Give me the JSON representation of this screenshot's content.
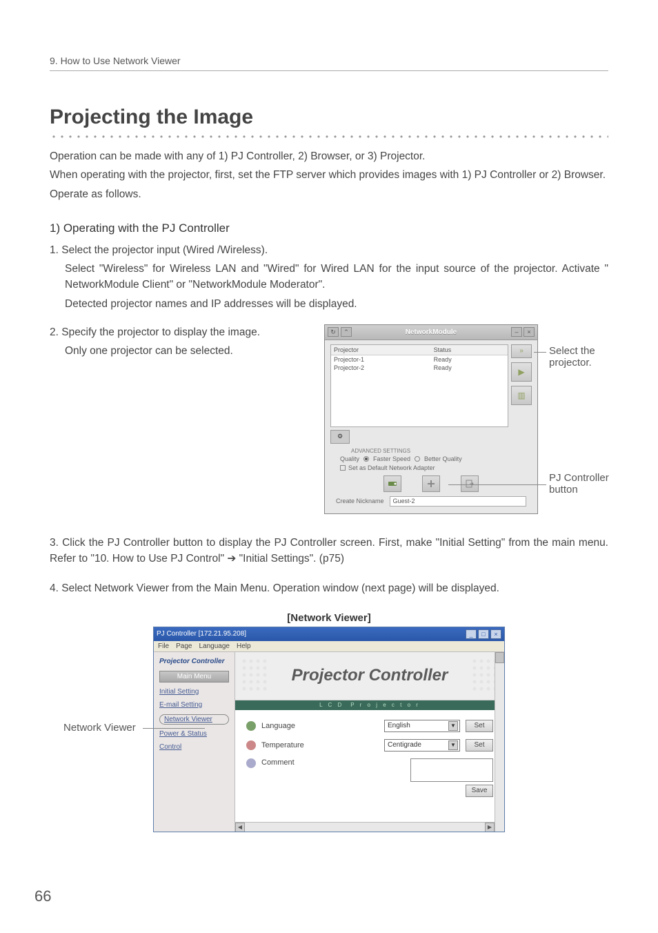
{
  "header": {
    "chapter": "9. How to Use Network Viewer"
  },
  "title": "Projecting the Image",
  "intro": {
    "p1": "Operation can be made with any of 1) PJ Controller, 2) Browser, or 3) Projector.",
    "p2": "When operating with the projector, first, set the FTP server which provides images with 1) PJ Controller or 2) Browser.",
    "p3": "Operate as follows."
  },
  "section1_title": "1) Operating with the PJ Controller",
  "steps": {
    "s1_num": "1. Select the projector input (Wired /Wireless).",
    "s1_body": "Select \"Wireless\" for Wireless LAN and \"Wired\" for Wired LAN for the input source of the projector.  Activate \" NetworkModule Client\" or \"NetworkModule Moderator\".",
    "s1_tail": "Detected projector names and IP addresses will be displayed.",
    "s2_num": "2. Specify the projector to display the image.",
    "s2_body": "Only one projector can be selected.",
    "s3": "3. Click the PJ Controller button to display the PJ Controller screen.  First, make \"Initial Setting\" from the main menu.  Refer to \"10. How to Use PJ Control\" ➔ \"Initial Settings\".  (p75)",
    "s4": "4. Select Network Viewer from the Main Menu. Operation window (next page) will be displayed."
  },
  "nm": {
    "title": "NetworkModule",
    "col_projector": "Projector",
    "col_status": "Status",
    "rows": [
      {
        "name": "Projector-1",
        "status": "Ready"
      },
      {
        "name": "Projector-2",
        "status": "Ready"
      }
    ],
    "adv_label": "ADVANCED SETTINGS",
    "quality_label": "Quality",
    "opt_faster": "Faster Speed",
    "opt_better": "Better Quality",
    "set_default": "Set as Default Network Adapter",
    "create_nick": "Create Nickname",
    "nick_value": "Guest-2"
  },
  "annotations": {
    "select_projector": "Select the projector.",
    "pj_button": "PJ Controller button"
  },
  "nv_caption": "[Network Viewer]",
  "nv_label": "Network Viewer",
  "pjc": {
    "title": "PJ Controller [172.21.95.208]",
    "menu": {
      "file": "File",
      "page": "Page",
      "language": "Language",
      "help": "Help"
    },
    "side_title": "Projector Controller",
    "side_mainmenu": "Main Menu",
    "side_initial": "Initial Setting",
    "side_email": "E-mail Setting",
    "side_nv": "Network Viewer",
    "side_power": "Power & Status",
    "side_control": "Control",
    "banner": "Projector Controller",
    "lcd_l": "L   C   D",
    "lcd_p": "P   r   o   j   e   c   t   o   r",
    "row_lang": "Language",
    "val_lang": "English",
    "row_temp": "Temperature",
    "val_temp": "Centigrade",
    "row_comment": "Comment",
    "btn_set": "Set",
    "btn_save": "Save"
  },
  "page_number": "66"
}
